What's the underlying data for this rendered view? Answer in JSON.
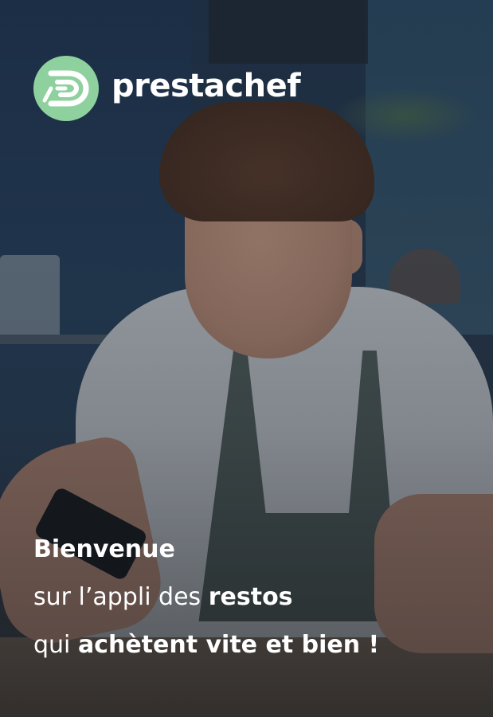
{
  "brand": {
    "name": "prestachef",
    "logo_icon": "prestachef-logo-icon",
    "accent_color": "#8fd19e"
  },
  "welcome": {
    "line1": "Bienvenue",
    "line2_prefix": "sur l’appli des ",
    "line2_bold": "restos",
    "line3_prefix": "qui ",
    "line3_bold": "achètent vite et bien !"
  },
  "background": {
    "image": "hero-photo-man-with-phone"
  }
}
